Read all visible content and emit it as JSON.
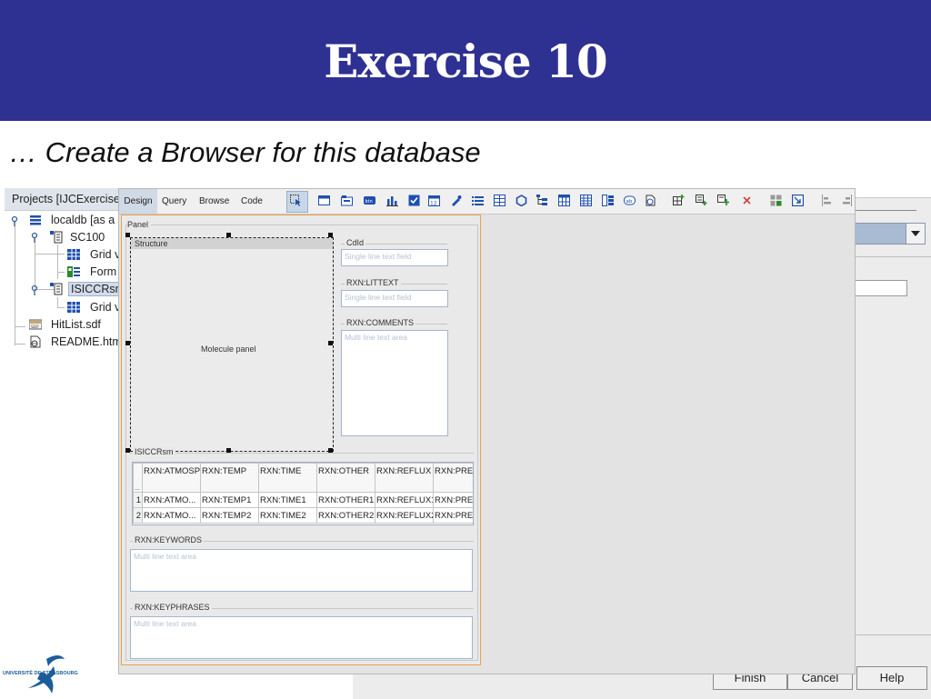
{
  "slide": {
    "title": "Exercise 10",
    "subtitle": "… Create a Browser for this database",
    "header_color": "#2e3192"
  },
  "project_panel": {
    "title": "Projects [IJCExercise",
    "tree": [
      {
        "label": "localdb [as a",
        "icon": "database-icon"
      },
      {
        "label": "SC100",
        "icon": "data-tree-icon"
      },
      {
        "label": "Grid v",
        "icon": "grid-view-icon"
      },
      {
        "label": "Form",
        "icon": "form-view-icon"
      },
      {
        "label": "ISICCRsm",
        "icon": "data-tree-icon",
        "selected": true
      },
      {
        "label": "Grid v",
        "icon": "grid-view-icon"
      },
      {
        "label": "HitList.sdf",
        "icon": "sdf-file-icon"
      },
      {
        "label": "README.htm",
        "icon": "html-file-icon"
      }
    ]
  },
  "designer": {
    "tabs": [
      "Design",
      "Query",
      "Browse",
      "Code"
    ],
    "active_tab": "Design",
    "toolbar_icons": [
      "select-tool-icon",
      "panel-icon",
      "tabbed-pane-icon",
      "button-icon",
      "chart-icon",
      "checkbox-icon",
      "calendar-icon",
      "link-icon",
      "list-icon",
      "table-icon",
      "hex-icon",
      "tree-icon",
      "grid-icon",
      "spreadsheet-icon",
      "text-icon",
      "text-area-icon",
      "html-icon",
      "add-grid-icon",
      "add-form-icon",
      "add-data-icon",
      "delete-icon",
      "layout-icon",
      "import-icon",
      "align-left-icon",
      "align-right-icon"
    ],
    "form": {
      "panel_label": "Panel",
      "structure_label": "Structure",
      "molecule_text": "Molecule panel",
      "cdid_label": "CdId",
      "cdid_placeholder": "Single line text field",
      "littext_label": "RXN:LITTEXT",
      "littext_placeholder": "Single line text field",
      "comments_label": "RXN:COMMENTS",
      "comments_placeholder": "Multi line text area",
      "table_label": "ISICCRsm",
      "table_columns": [
        "...",
        "RXN:ATMOSPH",
        "RXN:TEMP",
        "RXN:TIME",
        "RXN:OTHER",
        "RXN:REFLUX",
        "RXN:PRE"
      ],
      "table_rows": [
        [
          "1",
          "RXN:ATMO...",
          "RXN:TEMP1",
          "RXN:TIME1",
          "RXN:OTHER1",
          "RXN:REFLUX1",
          "RXN:PRE"
        ],
        [
          "2",
          "RXN:ATMO...",
          "RXN:TEMP2",
          "RXN:TIME2",
          "RXN:OTHER2",
          "RXN:REFLUX2",
          "RXN:PRE"
        ]
      ],
      "keywords_label": "RXN:KEYWORDS",
      "keywords_placeholder": "Multi line text area",
      "keyphrases_label": "RXN:KEYPHRASES",
      "keyphrases_placeholder": "Multi line text area"
    }
  },
  "wizard": {
    "finish_label": "Finish",
    "cancel_label": "Cancel",
    "help_label": "Help"
  },
  "logo": {
    "text": "UNIVERSITÉ DE STRASBOURG",
    "color": "#1d5c9a"
  }
}
